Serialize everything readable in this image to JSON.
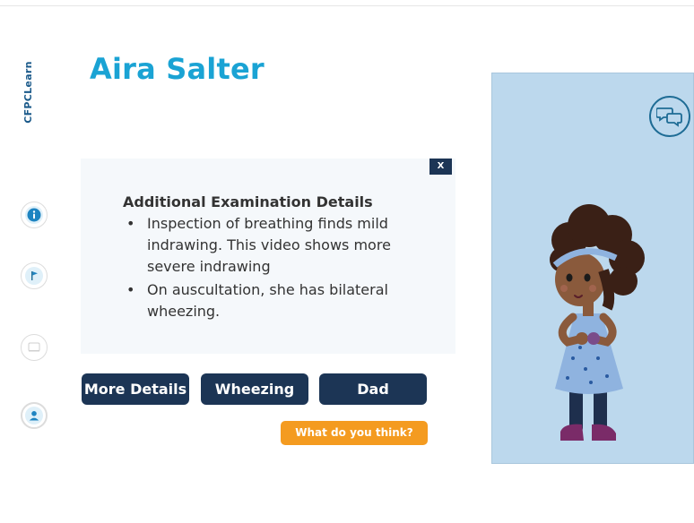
{
  "brand": {
    "logo_text": "CFPCLearn"
  },
  "patient": {
    "name": "Aira Salter"
  },
  "panel": {
    "close_label": "X",
    "heading": "Additional Examination Details",
    "bullets": [
      "Inspection of breathing finds mild indrawing.  This video shows more severe indrawing",
      "On auscultation, she has bilateral wheezing."
    ]
  },
  "buttons": {
    "more_details": "More Details",
    "wheezing": "Wheezing",
    "dad": "Dad",
    "what_do_you_think": "What do you think?"
  },
  "sidebar": {
    "icons": [
      "info-icon",
      "flag-icon",
      "notes-icon",
      "person-icon"
    ]
  },
  "colors": {
    "accent": "#1aa3d4",
    "dark_button": "#1c3555",
    "orange_button": "#f49b20",
    "scene_bg": "#bcd8ed"
  }
}
